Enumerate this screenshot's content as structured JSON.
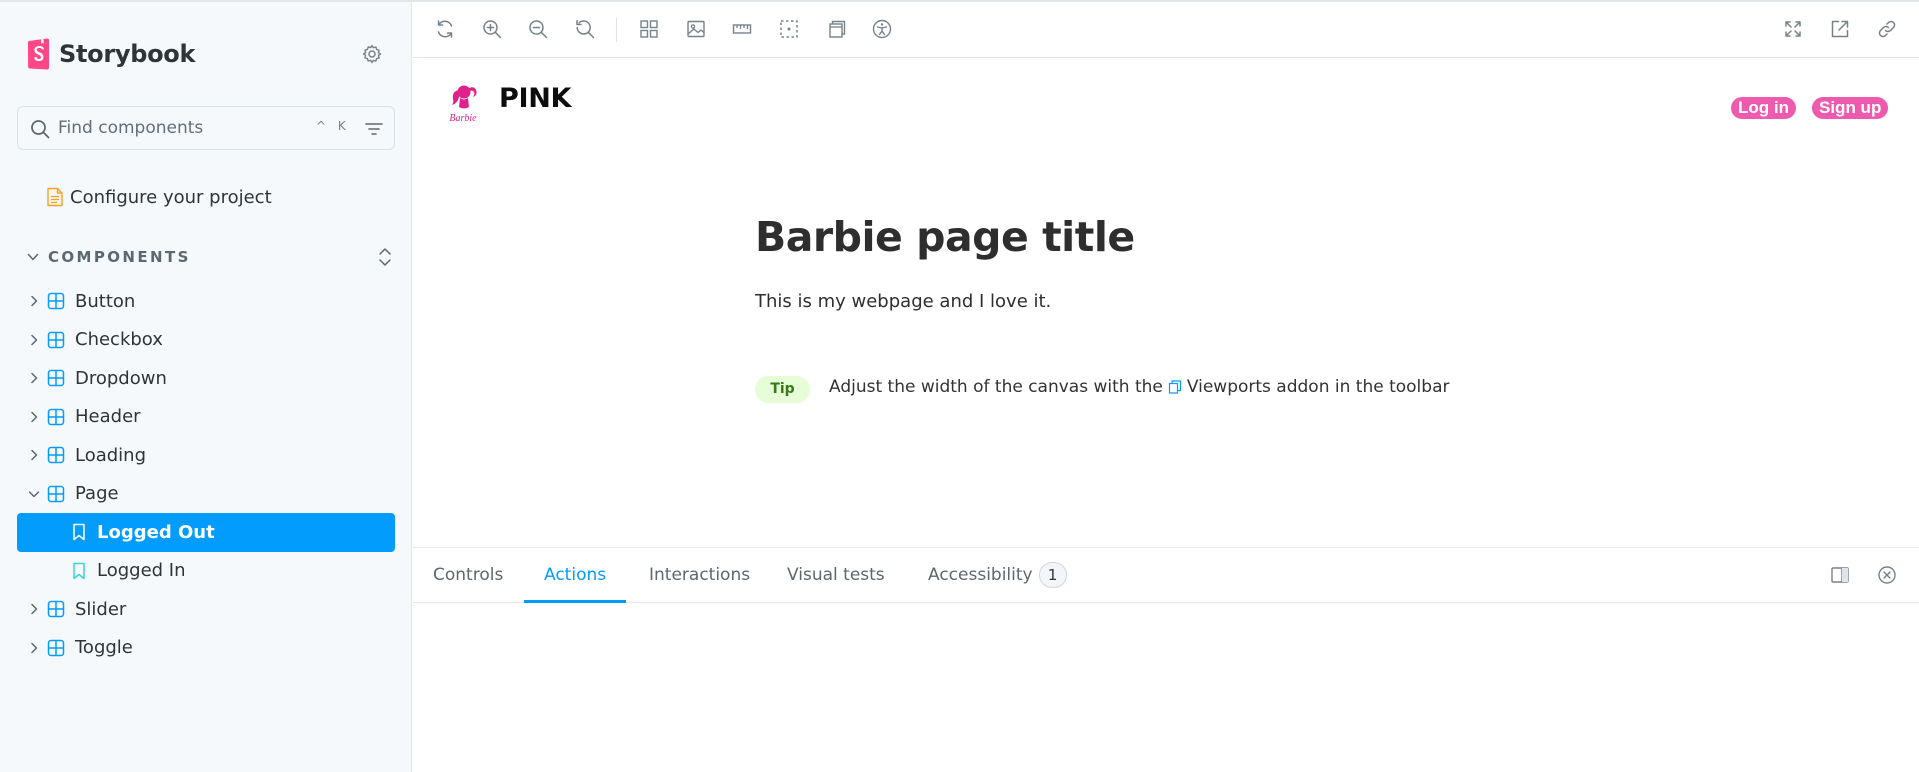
{
  "brand": {
    "name": "Storybook"
  },
  "search": {
    "placeholder": "Find components",
    "shortcut": "^ K"
  },
  "config": {
    "label": "Configure your project"
  },
  "section": {
    "title": "COMPONENTS"
  },
  "tree": {
    "button": "Button",
    "checkbox": "Checkbox",
    "dropdown": "Dropdown",
    "header": "Header",
    "loading": "Loading",
    "page": "Page",
    "logged_out": "Logged Out",
    "logged_in": "Logged In",
    "slider": "Slider",
    "toggle": "Toggle"
  },
  "preview": {
    "site_title": "PINK",
    "logo_text": "Barbie",
    "login_label": "Log in",
    "signup_label": "Sign up",
    "page_title": "Barbie page title",
    "description": "This is my webpage and I love it.",
    "tip_badge": "Tip",
    "tip_before": "Adjust the width of the canvas with the",
    "tip_after": "Viewports addon in the toolbar"
  },
  "panel": {
    "tabs": [
      "Controls",
      "Actions",
      "Interactions",
      "Visual tests",
      "Accessibility"
    ],
    "accessibility_count": "1"
  },
  "colors": {
    "accent": "#029cfd",
    "brand": "#ff4785",
    "barbie_pink": "#ee5bae",
    "tip_bg": "#e7fdd8"
  },
  "icons": {
    "toolbar": [
      "reload-icon",
      "zoom-in-icon",
      "zoom-out-icon",
      "zoom-reset-icon",
      "grid-icon",
      "background-icon",
      "measure-icon",
      "outline-icon",
      "viewport-icon",
      "accessibility-icon",
      "fullscreen-icon",
      "open-new-tab-icon",
      "copy-link-icon"
    ],
    "panel": [
      "panel-position-icon",
      "close-panel-icon"
    ]
  }
}
